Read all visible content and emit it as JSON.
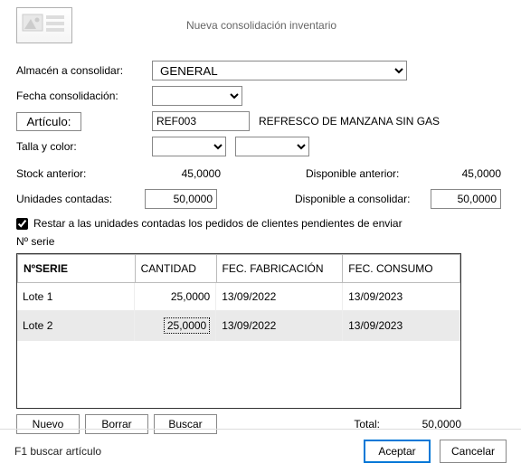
{
  "window": {
    "title": "Nueva consolidación inventario"
  },
  "form": {
    "almacen_label": "Almacén a consolidar:",
    "almacen_value": "GENERAL",
    "fecha_label": "Fecha consolidación:",
    "fecha_value": "",
    "articulo_button": "Artículo:",
    "articulo_value": "REF003",
    "articulo_desc": "REFRESCO DE MANZANA SIN GAS",
    "talla_label": "Talla y color:",
    "talla_value": "",
    "color_value": "",
    "stock_ant_label": "Stock anterior:",
    "stock_ant_value": "45,0000",
    "disp_ant_label": "Disponible anterior:",
    "disp_ant_value": "45,0000",
    "unid_cont_label": "Unidades contadas:",
    "unid_cont_value": "50,0000",
    "disp_cons_label": "Disponible a consolidar:",
    "disp_cons_value": "50,0000",
    "checkbox_label": "Restar a las unidades contadas los pedidos de clientes pendientes de enviar",
    "serial_label": "Nº serie"
  },
  "grid": {
    "headers": {
      "serie": "NºSERIE",
      "cantidad": "CANTIDAD",
      "fab": "FEC. FABRICACIÓN",
      "cons": "FEC. CONSUMO"
    },
    "rows": [
      {
        "serie": "Lote 1",
        "cantidad": "25,0000",
        "fab": "13/09/2022",
        "cons": "13/09/2023"
      },
      {
        "serie": "Lote 2",
        "cantidad": "25,0000",
        "fab": "13/09/2022",
        "cons": "13/09/2023"
      }
    ],
    "total_label": "Total:",
    "total_value": "50,0000",
    "buttons": {
      "nuevo": "Nuevo",
      "borrar": "Borrar",
      "buscar": "Buscar"
    }
  },
  "bottom": {
    "hint": "F1 buscar artículo",
    "accept": "Aceptar",
    "cancel": "Cancelar"
  }
}
